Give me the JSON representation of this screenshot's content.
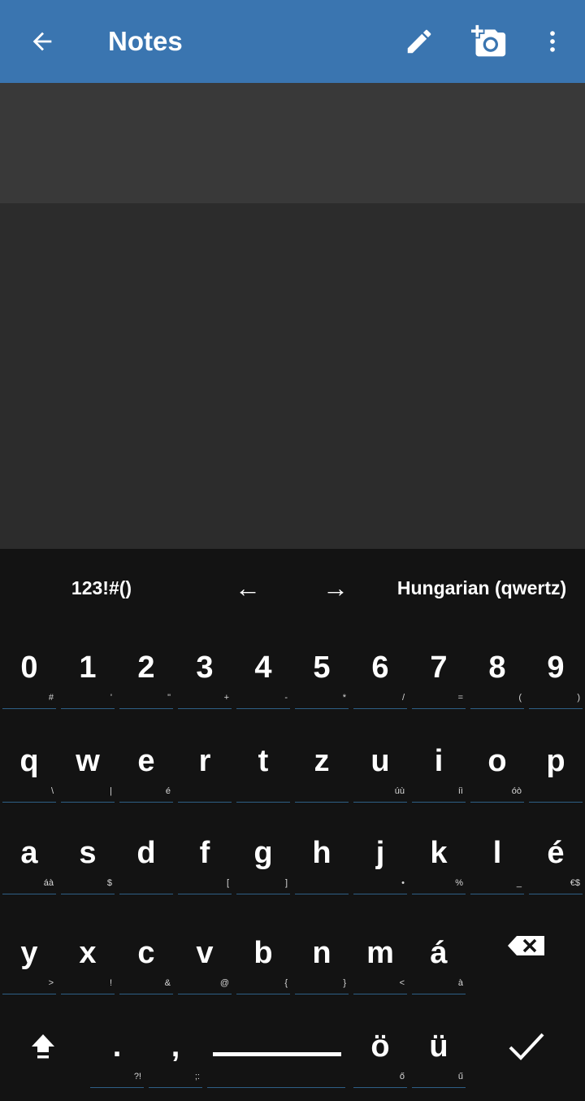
{
  "appbar": {
    "title": "Notes",
    "icons": {
      "back": "back-arrow-icon",
      "edit": "pencil-icon",
      "camera": "add-photo-icon",
      "more": "more-vert-icon"
    },
    "color": "#3a75b0"
  },
  "keyboard": {
    "toolbar": {
      "symbols": "123!#()",
      "left_arrow": "←",
      "right_arrow": "→",
      "language": "Hungarian (qwertz)"
    },
    "rows": [
      [
        {
          "k": "0",
          "h": "#"
        },
        {
          "k": "1",
          "h": "'"
        },
        {
          "k": "2",
          "h": "\""
        },
        {
          "k": "3",
          "h": "+"
        },
        {
          "k": "4",
          "h": "-"
        },
        {
          "k": "5",
          "h": "*"
        },
        {
          "k": "6",
          "h": "/"
        },
        {
          "k": "7",
          "h": "="
        },
        {
          "k": "8",
          "h": "("
        },
        {
          "k": "9",
          "h": ")"
        }
      ],
      [
        {
          "k": "q",
          "h": "\\"
        },
        {
          "k": "w",
          "h": "|"
        },
        {
          "k": "e",
          "h": "é"
        },
        {
          "k": "r",
          "h": ""
        },
        {
          "k": "t",
          "h": ""
        },
        {
          "k": "z",
          "h": ""
        },
        {
          "k": "u",
          "h": "úù"
        },
        {
          "k": "i",
          "h": "íì"
        },
        {
          "k": "o",
          "h": "óò"
        },
        {
          "k": "p",
          "h": ""
        }
      ],
      [
        {
          "k": "a",
          "h": "áà"
        },
        {
          "k": "s",
          "h": "$"
        },
        {
          "k": "d",
          "h": ""
        },
        {
          "k": "f",
          "h": "["
        },
        {
          "k": "g",
          "h": "]"
        },
        {
          "k": "h",
          "h": ""
        },
        {
          "k": "j",
          "h": "•"
        },
        {
          "k": "k",
          "h": "%"
        },
        {
          "k": "l",
          "h": "_"
        },
        {
          "k": "é",
          "h": "€$"
        }
      ],
      [
        {
          "k": "y",
          "h": ">"
        },
        {
          "k": "x",
          "h": "!"
        },
        {
          "k": "c",
          "h": "&"
        },
        {
          "k": "v",
          "h": "@"
        },
        {
          "k": "b",
          "h": "{"
        },
        {
          "k": "n",
          "h": "}"
        },
        {
          "k": "m",
          "h": "<"
        },
        {
          "k": "á",
          "h": "à"
        }
      ]
    ],
    "bottom": {
      "period": ".",
      "period_hint": "?!",
      "comma": ",",
      "comma_hint": ";:",
      "o_umlaut": "ö",
      "o_umlaut_hint": "ő",
      "u_umlaut": "ü",
      "u_umlaut_hint": "ű"
    },
    "icons": {
      "shift": "shift-icon",
      "backspace": "backspace-icon",
      "done": "checkmark-icon"
    }
  }
}
